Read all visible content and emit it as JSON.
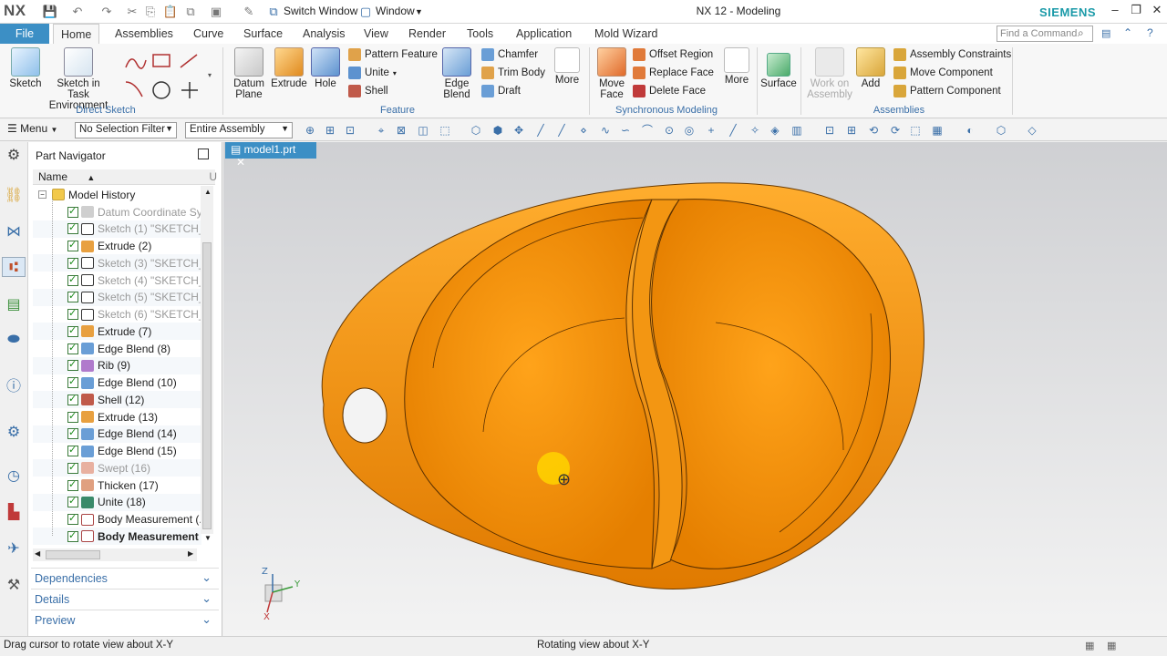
{
  "titlebar": {
    "logo": "NX",
    "switch_window": "Switch Window",
    "window_menu": "Window",
    "app_title": "NX 12 - Modeling",
    "brand": "SIEMENS",
    "search_placeholder": "Find a Command"
  },
  "tabs": [
    "File",
    "Home",
    "Assemblies",
    "Curve",
    "Surface",
    "Analysis",
    "View",
    "Render",
    "Tools",
    "Application",
    "Mold Wizard"
  ],
  "ribbon": {
    "direct_sketch": {
      "label": "Direct Sketch",
      "sketch": "Sketch",
      "sketch_task_line1": "Sketch in Task",
      "sketch_task_line2": "Environment"
    },
    "feature": {
      "label": "Feature",
      "datum_line1": "Datum",
      "datum_line2": "Plane",
      "extrude": "Extrude",
      "hole": "Hole",
      "pattern_feature": "Pattern Feature",
      "unite": "Unite",
      "shell": "Shell",
      "edge_line1": "Edge",
      "edge_line2": "Blend",
      "chamfer": "Chamfer",
      "trim_body": "Trim Body",
      "draft": "Draft",
      "more": "More"
    },
    "sync": {
      "label": "Synchronous Modeling",
      "move_line1": "Move",
      "move_line2": "Face",
      "offset_region": "Offset Region",
      "replace_face": "Replace Face",
      "delete_face": "Delete Face",
      "more": "More"
    },
    "surface": "Surface",
    "assemblies": {
      "label": "Assemblies",
      "work_line1": "Work on",
      "work_line2": "Assembly",
      "add": "Add",
      "assembly_constraints": "Assembly Constraints",
      "move_component": "Move Component",
      "pattern_component": "Pattern Component"
    }
  },
  "seltool": {
    "menu": "Menu",
    "filter": "No Selection Filter",
    "scope": "Entire Assembly"
  },
  "navigator": {
    "title": "Part Navigator",
    "col_name": "Name",
    "col_2": "U",
    "model_history": "Model History",
    "items": [
      {
        "label": "Datum Coordinate Sy...",
        "suppressed": true
      },
      {
        "label": "Sketch (1) \"SKETCH_0...",
        "suppressed": true
      },
      {
        "label": "Extrude (2)",
        "suppressed": false
      },
      {
        "label": "Sketch (3) \"SKETCH_0...",
        "suppressed": true
      },
      {
        "label": "Sketch (4) \"SKETCH_0...",
        "suppressed": true
      },
      {
        "label": "Sketch (5) \"SKETCH_0...",
        "suppressed": true
      },
      {
        "label": "Sketch (6) \"SKETCH_0...",
        "suppressed": true
      },
      {
        "label": "Extrude (7)",
        "suppressed": false
      },
      {
        "label": "Edge Blend (8)",
        "suppressed": false
      },
      {
        "label": "Rib (9)",
        "suppressed": false
      },
      {
        "label": "Edge Blend (10)",
        "suppressed": false
      },
      {
        "label": "Shell (12)",
        "suppressed": false
      },
      {
        "label": "Extrude (13)",
        "suppressed": false
      },
      {
        "label": "Edge Blend (14)",
        "suppressed": false
      },
      {
        "label": "Edge Blend (15)",
        "suppressed": false
      },
      {
        "label": "Swept (16)",
        "suppressed": true
      },
      {
        "label": "Thicken (17)",
        "suppressed": false
      },
      {
        "label": "Unite (18)",
        "suppressed": false
      },
      {
        "label": "Body Measurement (...",
        "suppressed": false
      },
      {
        "label": "Body Measurement ...",
        "suppressed": false
      }
    ],
    "dependencies": "Dependencies",
    "details": "Details",
    "preview": "Preview"
  },
  "graphics": {
    "doc_tab": "model1.prt",
    "axis_z": "Z",
    "axis_y": "Y",
    "axis_x": "X",
    "model_color": "#f59a16"
  },
  "status": {
    "left": "Drag cursor to rotate view about X-Y",
    "center": "Rotating view about X-Y"
  }
}
